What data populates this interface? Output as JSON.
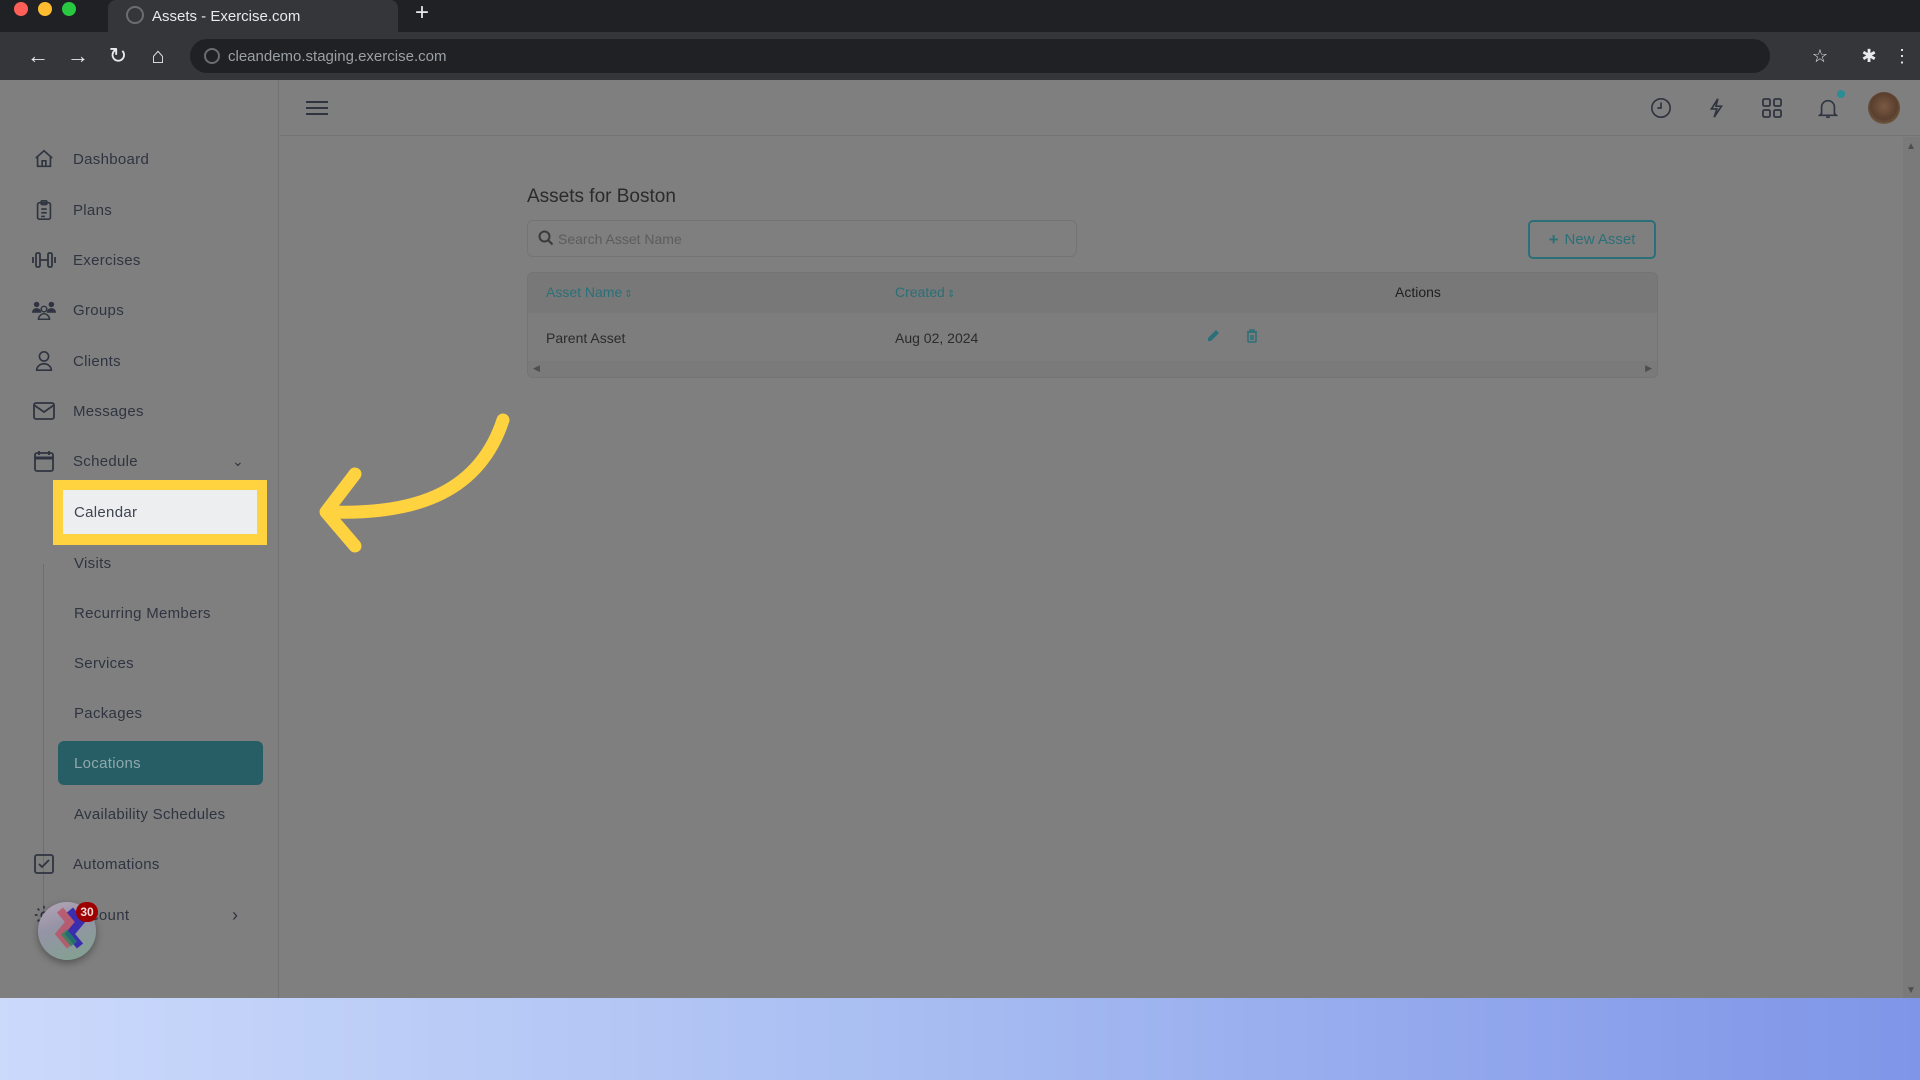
{
  "browser": {
    "tab_title": "Assets - Exercise.com",
    "url": "cleandemo.staging.exercise.com",
    "new_tab_label": "+"
  },
  "sidebar": {
    "items": [
      {
        "label": "Dashboard",
        "icon": "home-icon"
      },
      {
        "label": "Plans",
        "icon": "clipboard-icon"
      },
      {
        "label": "Exercises",
        "icon": "dumbbell-icon"
      },
      {
        "label": "Groups",
        "icon": "group-icon"
      },
      {
        "label": "Clients",
        "icon": "user-icon"
      },
      {
        "label": "Messages",
        "icon": "envelope-icon"
      },
      {
        "label": "Schedule",
        "icon": "calendar-icon",
        "expanded": true
      }
    ],
    "schedule_subitems": [
      {
        "label": "Calendar",
        "highlighted": true
      },
      {
        "label": "Visits"
      },
      {
        "label": "Recurring Members"
      },
      {
        "label": "Services"
      },
      {
        "label": "Packages"
      },
      {
        "label": "Locations",
        "active": true
      },
      {
        "label": "Availability Schedules"
      }
    ],
    "bottom_items": [
      {
        "label": "Automations",
        "icon": "checkbox-icon"
      },
      {
        "label": "Account",
        "icon": "gear-icon"
      }
    ],
    "widget_badge": "30"
  },
  "header": {
    "icons": [
      "clock-icon",
      "lightning-icon",
      "apps-grid-icon",
      "bell-icon",
      "avatar"
    ]
  },
  "main": {
    "title": "Assets for Boston",
    "search_placeholder": "Search Asset Name",
    "search_value": "",
    "new_asset_label": "New Asset",
    "table": {
      "columns": [
        "Asset Name",
        "Created",
        "Actions"
      ],
      "rows": [
        {
          "name": "Parent Asset",
          "created": "Aug 02, 2024"
        }
      ]
    }
  },
  "colors": {
    "accent": "#2b7078",
    "active_nav": "#275e66",
    "highlight": "#ffd23f",
    "overlay": "#7f7f7f"
  }
}
